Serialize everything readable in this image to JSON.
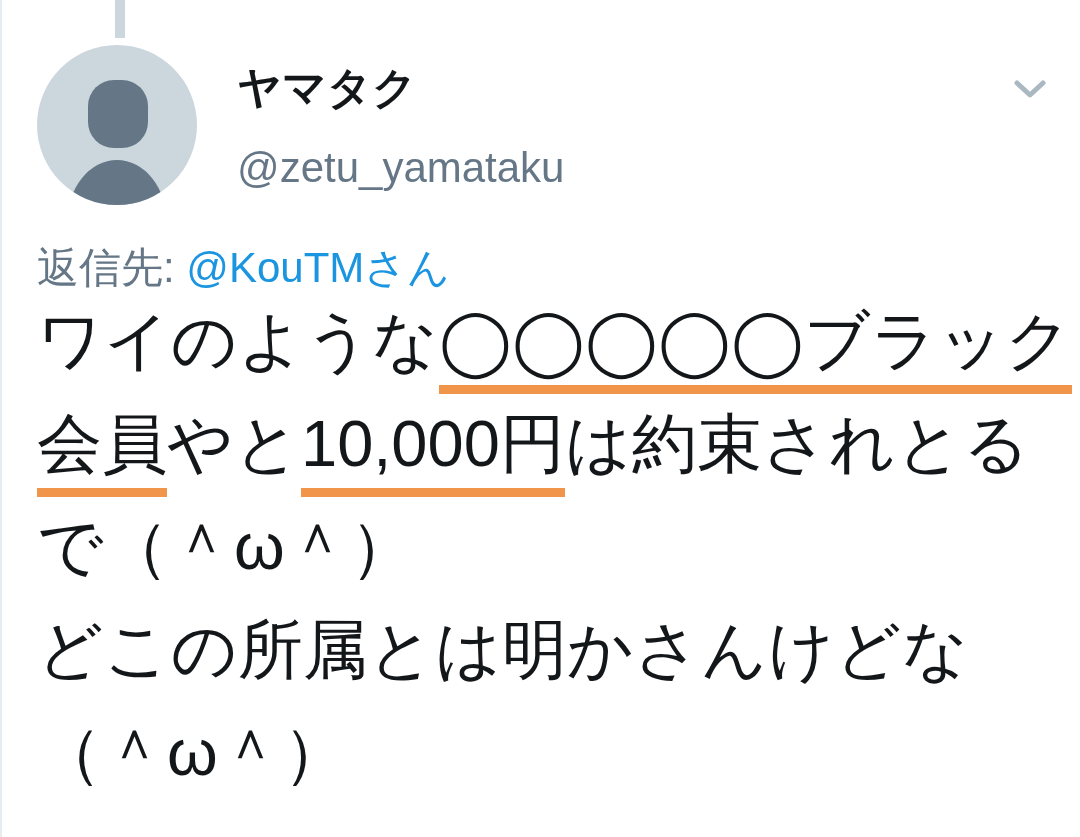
{
  "tweet": {
    "author": {
      "name": "ヤマタク",
      "handle": "@zetu_yamataku"
    },
    "reply_to": {
      "label": "返信先:",
      "mention": "@KouTMさん"
    },
    "lines": [
      {
        "segments": [
          {
            "text": "ワイのような",
            "underlined": false
          },
          {
            "text": "◯◯◯◯◯ブラック",
            "underlined": true
          }
        ]
      },
      {
        "segments": [
          {
            "text": "会員",
            "underlined": true
          },
          {
            "text": "やと",
            "underlined": false
          },
          {
            "text": "10,000円",
            "underlined": true
          },
          {
            "text": "は約束されとる",
            "underlined": false
          }
        ]
      },
      {
        "segments": [
          {
            "text": "で（＾ω＾）",
            "underlined": false
          }
        ]
      },
      {
        "segments": [
          {
            "text": "どこの所属とは明かさんけどな",
            "underlined": false
          }
        ]
      },
      {
        "segments": [
          {
            "text": "（＾ω＾）",
            "underlined": false
          }
        ]
      }
    ]
  }
}
